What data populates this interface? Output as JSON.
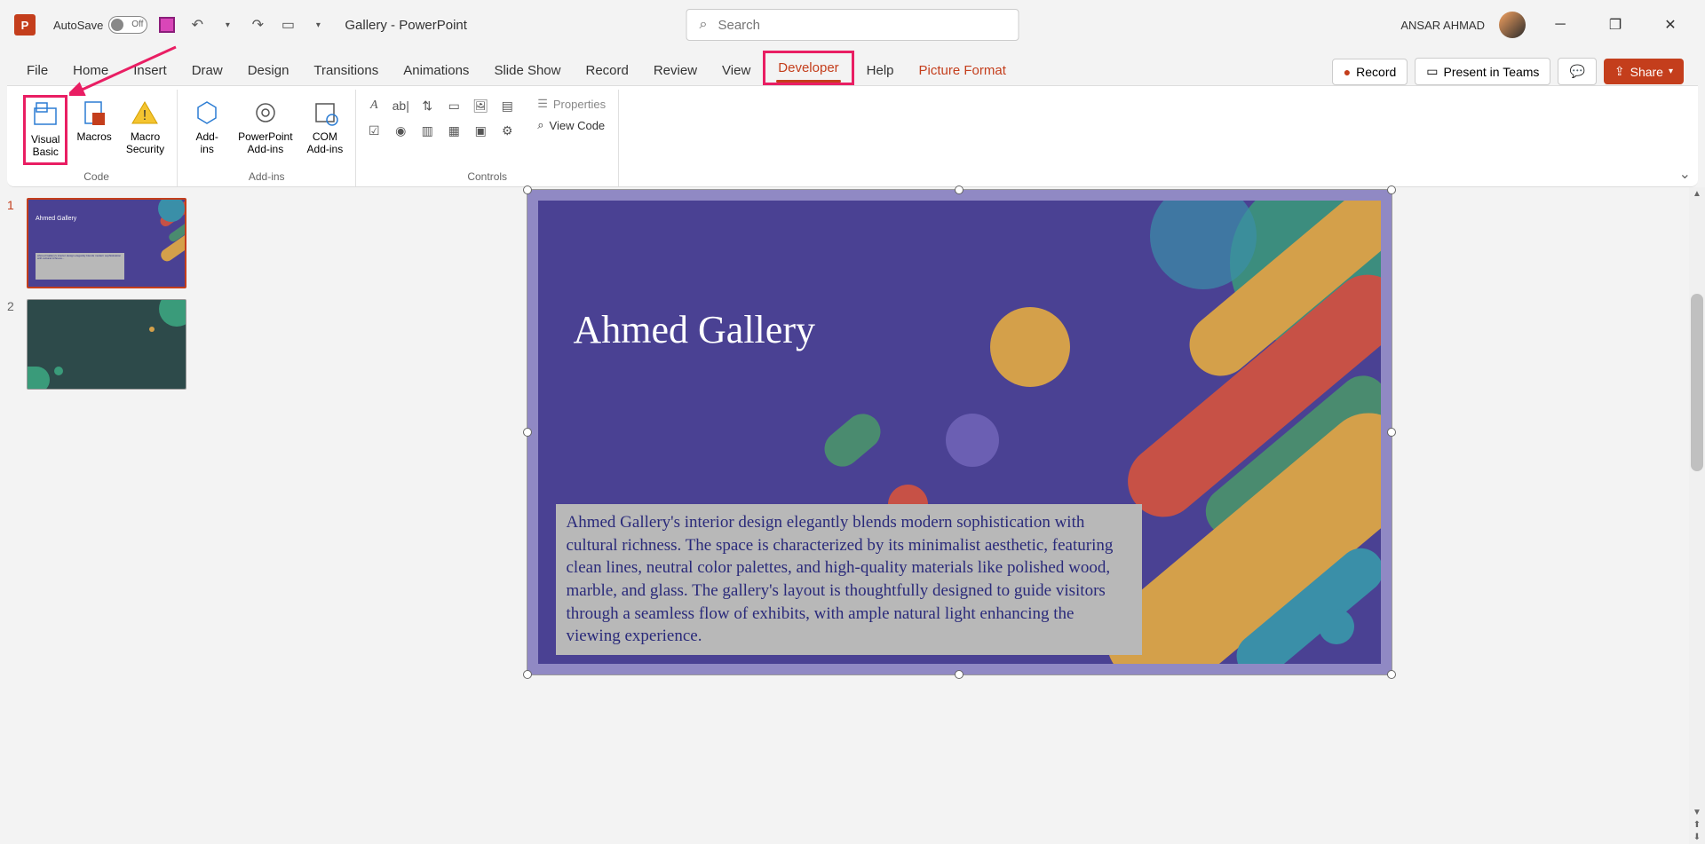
{
  "titlebar": {
    "autosave_label": "AutoSave",
    "autosave_state": "Off",
    "doc_title": "Gallery  -  PowerPoint",
    "search_placeholder": "Search",
    "username": "ANSAR AHMAD"
  },
  "tabs": {
    "items": [
      "File",
      "Home",
      "Insert",
      "Draw",
      "Design",
      "Transitions",
      "Animations",
      "Slide Show",
      "Record",
      "Review",
      "View",
      "Developer",
      "Help",
      "Picture Format"
    ],
    "active_index": 11,
    "record_btn": "Record",
    "present_btn": "Present in Teams",
    "share_btn": "Share"
  },
  "ribbon": {
    "code": {
      "label": "Code",
      "visual_basic": "Visual\nBasic",
      "macros": "Macros",
      "macro_security": "Macro\nSecurity"
    },
    "addins": {
      "label": "Add-ins",
      "addins": "Add-\nins",
      "ppt_addins": "PowerPoint\nAdd-ins",
      "com_addins": "COM\nAdd-ins"
    },
    "controls": {
      "label": "Controls",
      "properties": "Properties",
      "view_code": "View Code"
    }
  },
  "thumbnails": {
    "items": [
      {
        "num": "1",
        "title": "Ahmed Gallery"
      },
      {
        "num": "2",
        "title": ""
      }
    ]
  },
  "slide": {
    "title": "Ahmed Gallery",
    "body": "Ahmed Gallery's interior design elegantly blends modern sophistication with cultural richness. The space is characterized by its minimalist aesthetic, featuring clean lines, neutral color palettes, and high-quality materials like polished wood, marble, and glass. The gallery's layout is thoughtfully designed to guide visitors through a seamless flow of exhibits, with ample natural light enhancing the viewing experience."
  }
}
